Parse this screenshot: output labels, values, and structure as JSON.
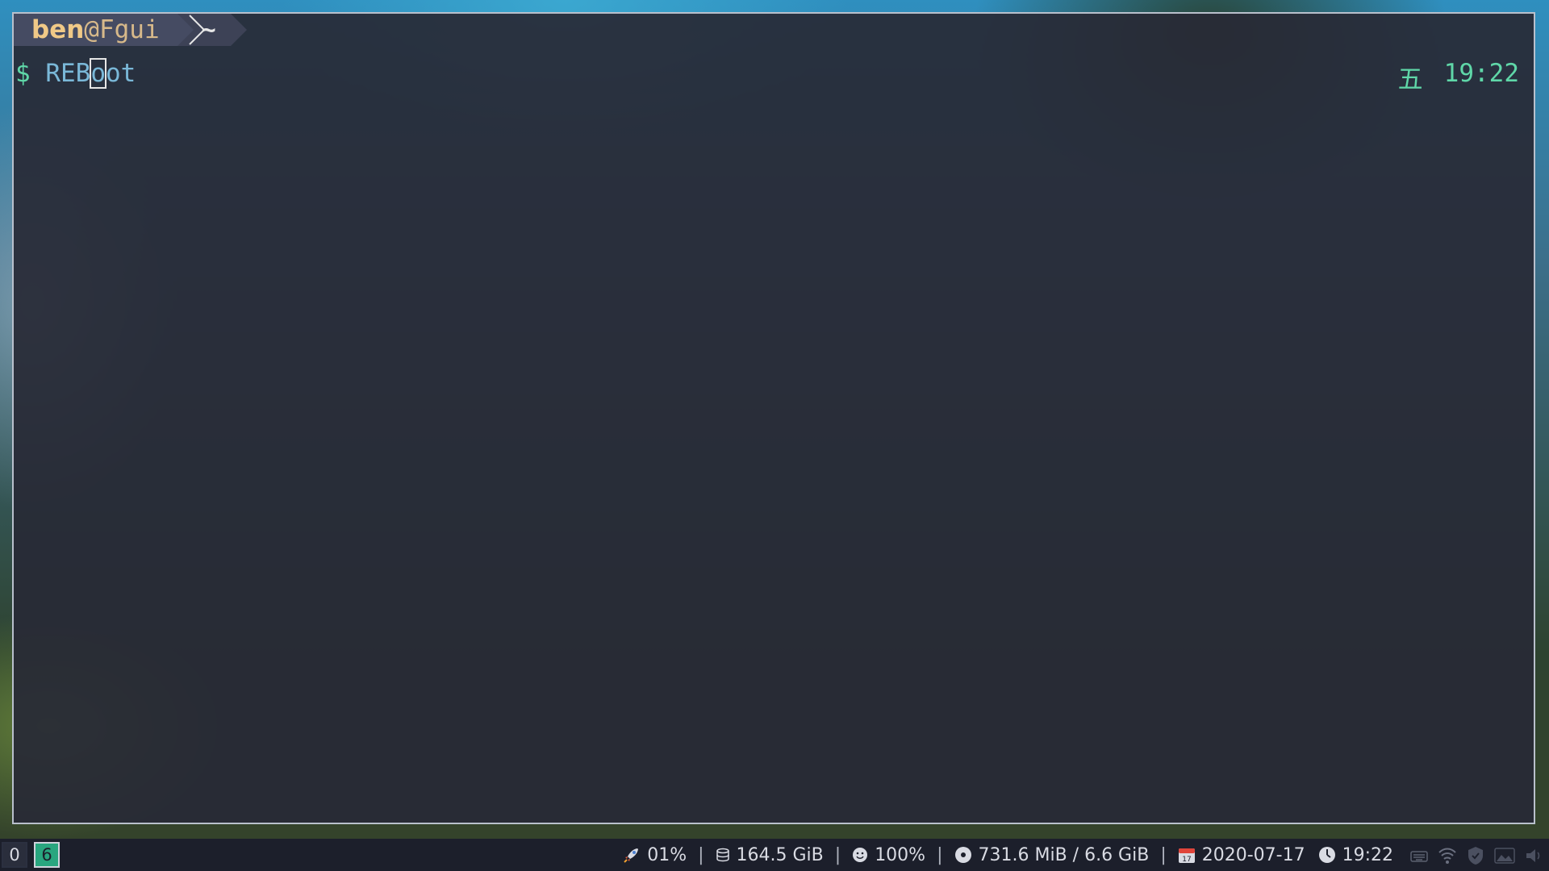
{
  "terminal": {
    "prompt": {
      "user": "ben",
      "at": "@",
      "host": "Fgui",
      "directory": "~"
    },
    "command": {
      "symbol": "$",
      "typed_before_cursor": "REB",
      "cursor_char": "o",
      "typed_after_cursor": "ot"
    },
    "right_prompt": {
      "day": "五",
      "time": "19:22"
    }
  },
  "statusbar": {
    "workspaces": [
      "0",
      "6"
    ],
    "active_workspace": "6",
    "items": {
      "cpu": {
        "icon": "rocket-icon",
        "value": "01%"
      },
      "disk": {
        "icon": "disk-icon",
        "value": "164.5 GiB"
      },
      "battery": {
        "icon": "smiley-icon",
        "value": "100%"
      },
      "memory": {
        "icon": "memory-icon",
        "value": "731.6 MiB / 6.6 GiB"
      },
      "date": {
        "icon": "calendar-icon",
        "value": "2020-07-17"
      },
      "clock": {
        "icon": "clock-icon",
        "value": "19:22"
      }
    },
    "separator": "|",
    "tray": [
      "keyboard-icon",
      "wifi-icon",
      "shield-icon",
      "image-icon",
      "volume-icon"
    ]
  },
  "colors": {
    "accent_green": "#5fd7a8",
    "command_blue": "#7ab8d8",
    "prompt_user": "#f0c987",
    "workspace_active": "#29a67f"
  }
}
